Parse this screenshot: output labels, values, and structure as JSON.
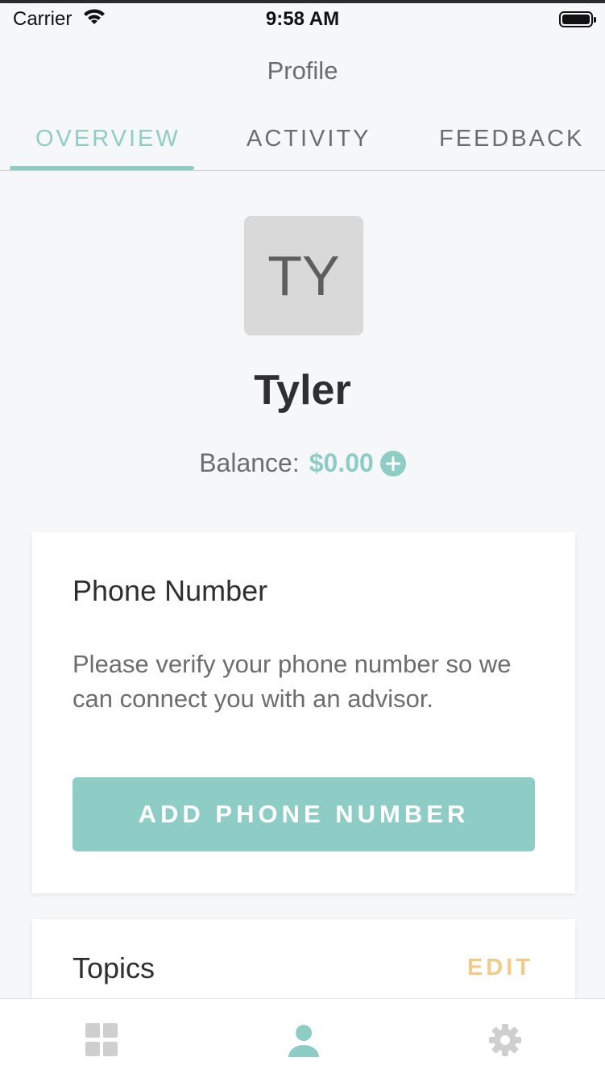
{
  "status_bar": {
    "carrier": "Carrier",
    "time": "9:58 AM"
  },
  "nav": {
    "title": "Profile"
  },
  "tabs": [
    {
      "label": "OVERVIEW",
      "active": true
    },
    {
      "label": "ACTIVITY",
      "active": false
    },
    {
      "label": "FEEDBACK",
      "active": false
    }
  ],
  "profile": {
    "initials": "TY",
    "name": "Tyler",
    "balance_label": "Balance:",
    "balance_value": "$0.00"
  },
  "phone_card": {
    "title": "Phone Number",
    "text": "Please verify your phone number so we can connect you with an advisor.",
    "button_label": "ADD PHONE NUMBER"
  },
  "topics_card": {
    "title": "Topics",
    "edit_label": "EDIT"
  },
  "bottom_nav": [
    {
      "icon": "dashboard-grid-icon",
      "active": false
    },
    {
      "icon": "user-profile-icon",
      "active": true
    },
    {
      "icon": "settings-gear-icon",
      "active": false
    }
  ],
  "colors": {
    "accent": "#8ecdc5",
    "edit_accent": "#f3cb87",
    "inactive_icon": "#cfcfcf",
    "background": "#f6f7f9"
  }
}
